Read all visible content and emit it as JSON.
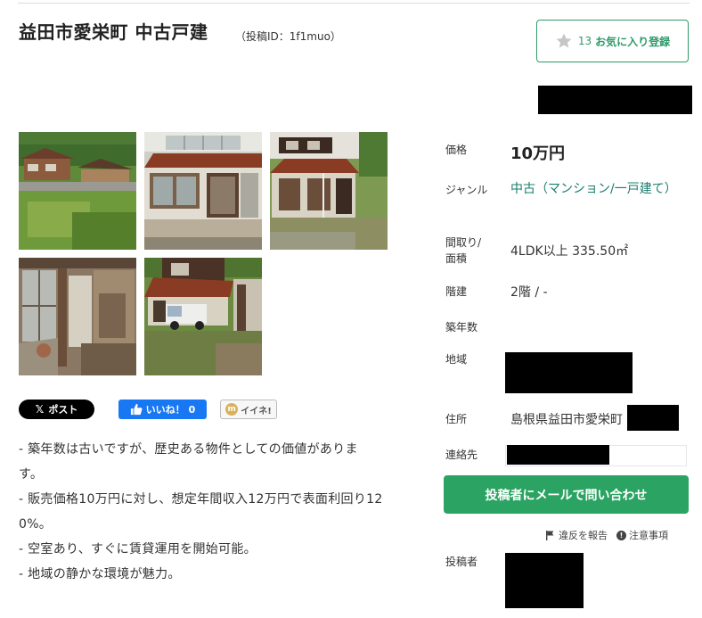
{
  "header": {
    "title": "益田市愛栄町 中古戸建",
    "post_id": "（投稿ID：1f1muo）",
    "favorite": {
      "count": "13",
      "label": "お気に入り登録"
    }
  },
  "gallery": {
    "photos": [
      "house-exterior-hillside",
      "house-entrance",
      "house-side-wall",
      "veranda-corridor",
      "yard-with-truck"
    ]
  },
  "share": {
    "x_label": "ポスト",
    "fb_label": "いいね！",
    "fb_count": "0",
    "iine_label": "イイネ!"
  },
  "description": {
    "lines": [
      "- 築年数は古いですが、歴史ある物件としての価値がありま",
      "す。",
      "- 販売価格10万円に対し、想定年間収入12万円で表面利回り12",
      "0%。",
      "- 空室あり、すぐに賃貸運用を開始可能。",
      "- 地域の静かな環境が魅力。"
    ]
  },
  "details": {
    "price_label": "価格",
    "price_value": "10万円",
    "genre_label": "ジャンル",
    "genre_value": "中古（マンション/一戸建て）",
    "layout_label_1": "間取り/",
    "layout_label_2": "面積",
    "layout_value": "4LDK以上 335.50㎡",
    "floors_label": "階建",
    "floors_value": "2階 / -",
    "age_label": "築年数",
    "area_label": "地域",
    "address_label": "住所",
    "address_value": "島根県益田市愛栄町",
    "contact_label": "連絡先",
    "poster_label": "投稿者"
  },
  "actions": {
    "contact_button": "投稿者にメールで問い合わせ",
    "report_label": "違反を報告",
    "notice_label": "注意事項"
  },
  "colors": {
    "accent": "#2ba362",
    "link": "#1a7d6e",
    "facebook": "#1877f2"
  }
}
